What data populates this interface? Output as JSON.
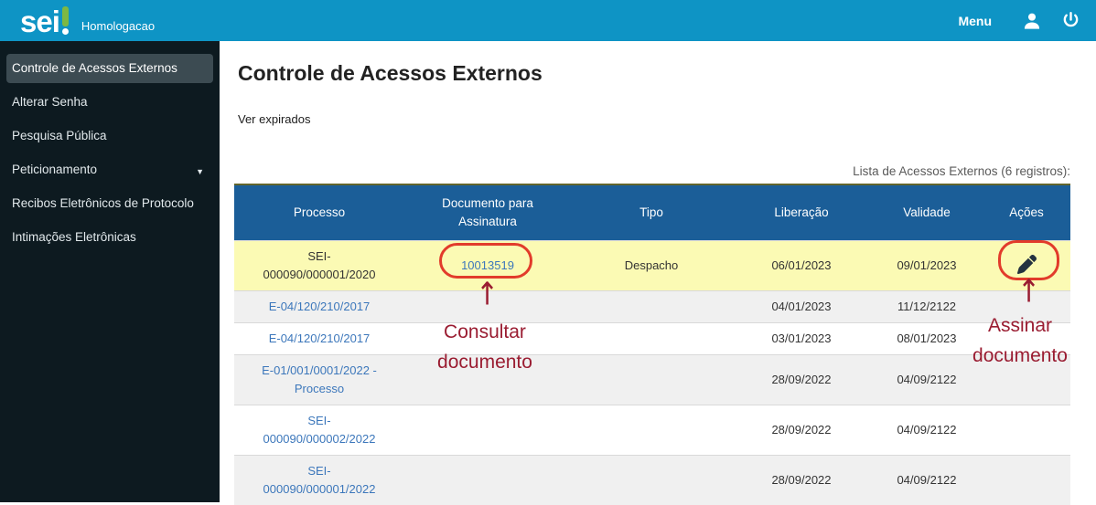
{
  "header": {
    "logo_text": "sei",
    "environment": "Homologacao",
    "menu_label": "Menu",
    "icons": {
      "user": "user-icon",
      "power": "power-icon"
    }
  },
  "sidebar": {
    "items": [
      {
        "label": "Controle de Acessos Externos",
        "active": true,
        "has_submenu": false
      },
      {
        "label": "Alterar Senha",
        "active": false,
        "has_submenu": false
      },
      {
        "label": "Pesquisa Pública",
        "active": false,
        "has_submenu": false
      },
      {
        "label": "Peticionamento",
        "active": false,
        "has_submenu": true
      },
      {
        "label": "Recibos Eletrônicos de Protocolo",
        "active": false,
        "has_submenu": false
      },
      {
        "label": "Intimações Eletrônicas",
        "active": false,
        "has_submenu": false
      }
    ]
  },
  "main": {
    "title": "Controle de Acessos Externos",
    "ver_expirados_label": "Ver expirados",
    "list_caption": "Lista de Acessos Externos (6 registros):"
  },
  "table": {
    "columns": [
      "Processo",
      "Documento para Assinatura",
      "Tipo",
      "Liberação",
      "Validade",
      "Ações"
    ],
    "rows": [
      {
        "processo": "SEI-000090/000001/2020",
        "processo_is_link": false,
        "documento": "10013519",
        "documento_is_link": true,
        "tipo": "Despacho",
        "liberacao": "06/01/2023",
        "validade": "09/01/2023",
        "acao_icon": "sign-pen-icon",
        "highlight": true
      },
      {
        "processo": "E-04/120/210/2017",
        "processo_is_link": true,
        "documento": "",
        "documento_is_link": false,
        "tipo": "",
        "liberacao": "04/01/2023",
        "validade": "11/12/2122",
        "acao_icon": "",
        "highlight": false
      },
      {
        "processo": "E-04/120/210/2017",
        "processo_is_link": true,
        "documento": "",
        "documento_is_link": false,
        "tipo": "",
        "liberacao": "03/01/2023",
        "validade": "08/01/2023",
        "acao_icon": "",
        "highlight": false
      },
      {
        "processo": "E-01/001/0001/2022 - Processo",
        "processo_is_link": true,
        "documento": "",
        "documento_is_link": false,
        "tipo": "",
        "liberacao": "28/09/2022",
        "validade": "04/09/2122",
        "acao_icon": "",
        "highlight": false
      },
      {
        "processo": "SEI-000090/000002/2022",
        "processo_is_link": true,
        "documento": "",
        "documento_is_link": false,
        "tipo": "",
        "liberacao": "28/09/2022",
        "validade": "04/09/2122",
        "acao_icon": "",
        "highlight": false
      },
      {
        "processo": "SEI-000090/000001/2022",
        "processo_is_link": true,
        "documento": "",
        "documento_is_link": false,
        "tipo": "",
        "liberacao": "28/09/2022",
        "validade": "04/09/2122",
        "acao_icon": "",
        "highlight": false
      }
    ]
  },
  "annotations": {
    "consultar": {
      "arrow": "↑",
      "line1": "Consultar",
      "line2": "documento"
    },
    "assinar": {
      "arrow": "↑",
      "line1": "Assinar",
      "line2": "documento"
    }
  },
  "colors": {
    "header_blue": "#0e94c5",
    "sidebar_bg": "#0d1a20",
    "sidebar_active_bg": "#3c4b52",
    "table_header_blue": "#1b5e98",
    "highlight_yellow": "#fbfab4",
    "row_alt_gray": "#f0f0f0",
    "link_blue": "#3c77bb",
    "logo_green": "#7db843",
    "annotation_text_red": "#9a1c31",
    "annotation_circle_red": "#e23b2b",
    "pen_icon_dark": "#243240"
  }
}
